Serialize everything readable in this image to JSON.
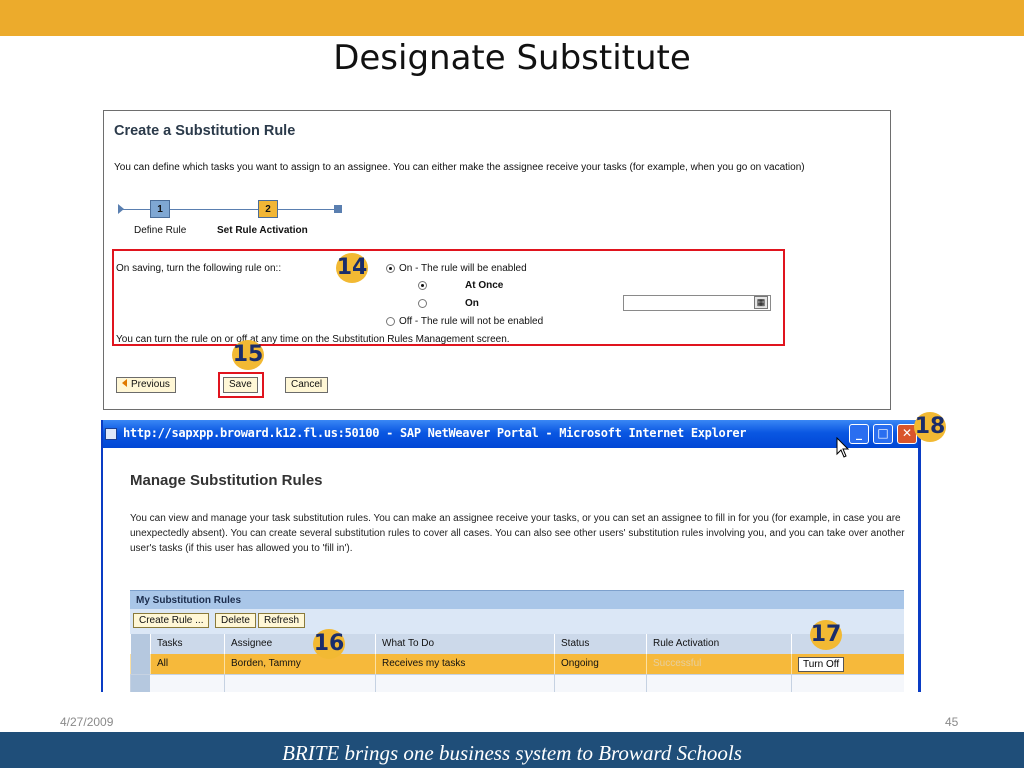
{
  "slide": {
    "title": "Designate Substitute",
    "date": "4/27/2009",
    "page_number": "45",
    "footer": "BRITE brings one business system to Broward Schools"
  },
  "create_rule": {
    "title": "Create a Substitution Rule",
    "description": "You can define which tasks you want to assign to an assignee. You can either make the assignee receive your tasks (for example, when you go on vacation)",
    "steps": [
      {
        "number": "1",
        "label": "Define Rule"
      },
      {
        "number": "2",
        "label": "Set Rule Activation"
      }
    ],
    "saving_label": "On saving, turn the following rule on::",
    "option_on": "On - The rule will be enabled",
    "option_at_once": "At Once",
    "option_on_date": "On",
    "option_off": "Off - The rule will not be enabled",
    "date_value": "",
    "note": "You can turn the rule on or off at any time on the Substitution Rules Management screen.",
    "previous_button": "Previous",
    "save_button": "Save",
    "cancel_button": "Cancel"
  },
  "callouts": {
    "c14": "14",
    "c15": "15",
    "c16": "16",
    "c17": "17",
    "c18": "18"
  },
  "ie_window": {
    "title": "http://sapxpp.broward.k12.fl.us:50100 - SAP NetWeaver Portal - Microsoft Internet Explorer",
    "manage_title": "Manage Substitution Rules",
    "manage_description": "You can view and manage your task substitution rules. You can make an assignee receive your tasks, or you can set an assignee to fill in for you (for example, in case you are unexpectedly absent). You can create several substitution rules to cover all cases. You can also see other users' substitution rules involving you, and you can take over another user's tasks (if this user has allowed you to 'fill in').",
    "table_title": "My Substitution Rules",
    "toolbar": {
      "create_rule": "Create Rule ...",
      "delete": "Delete",
      "refresh": "Refresh"
    },
    "columns": [
      "Tasks",
      "Assignee",
      "What To Do",
      "Status",
      "Rule Activation"
    ],
    "rows": [
      {
        "tasks": "All",
        "assignee": "Borden, Tammy",
        "what_to_do": "Receives my tasks",
        "status": "Ongoing",
        "rule_activation": "Successful",
        "action": "Turn Off"
      }
    ]
  },
  "colors": {
    "top_bar": "#ecab2c",
    "bottom_bar": "#1f4e79",
    "highlight_box": "#e0141e",
    "callout_fill": "#f2b933",
    "selected_row": "#f6b93b"
  }
}
